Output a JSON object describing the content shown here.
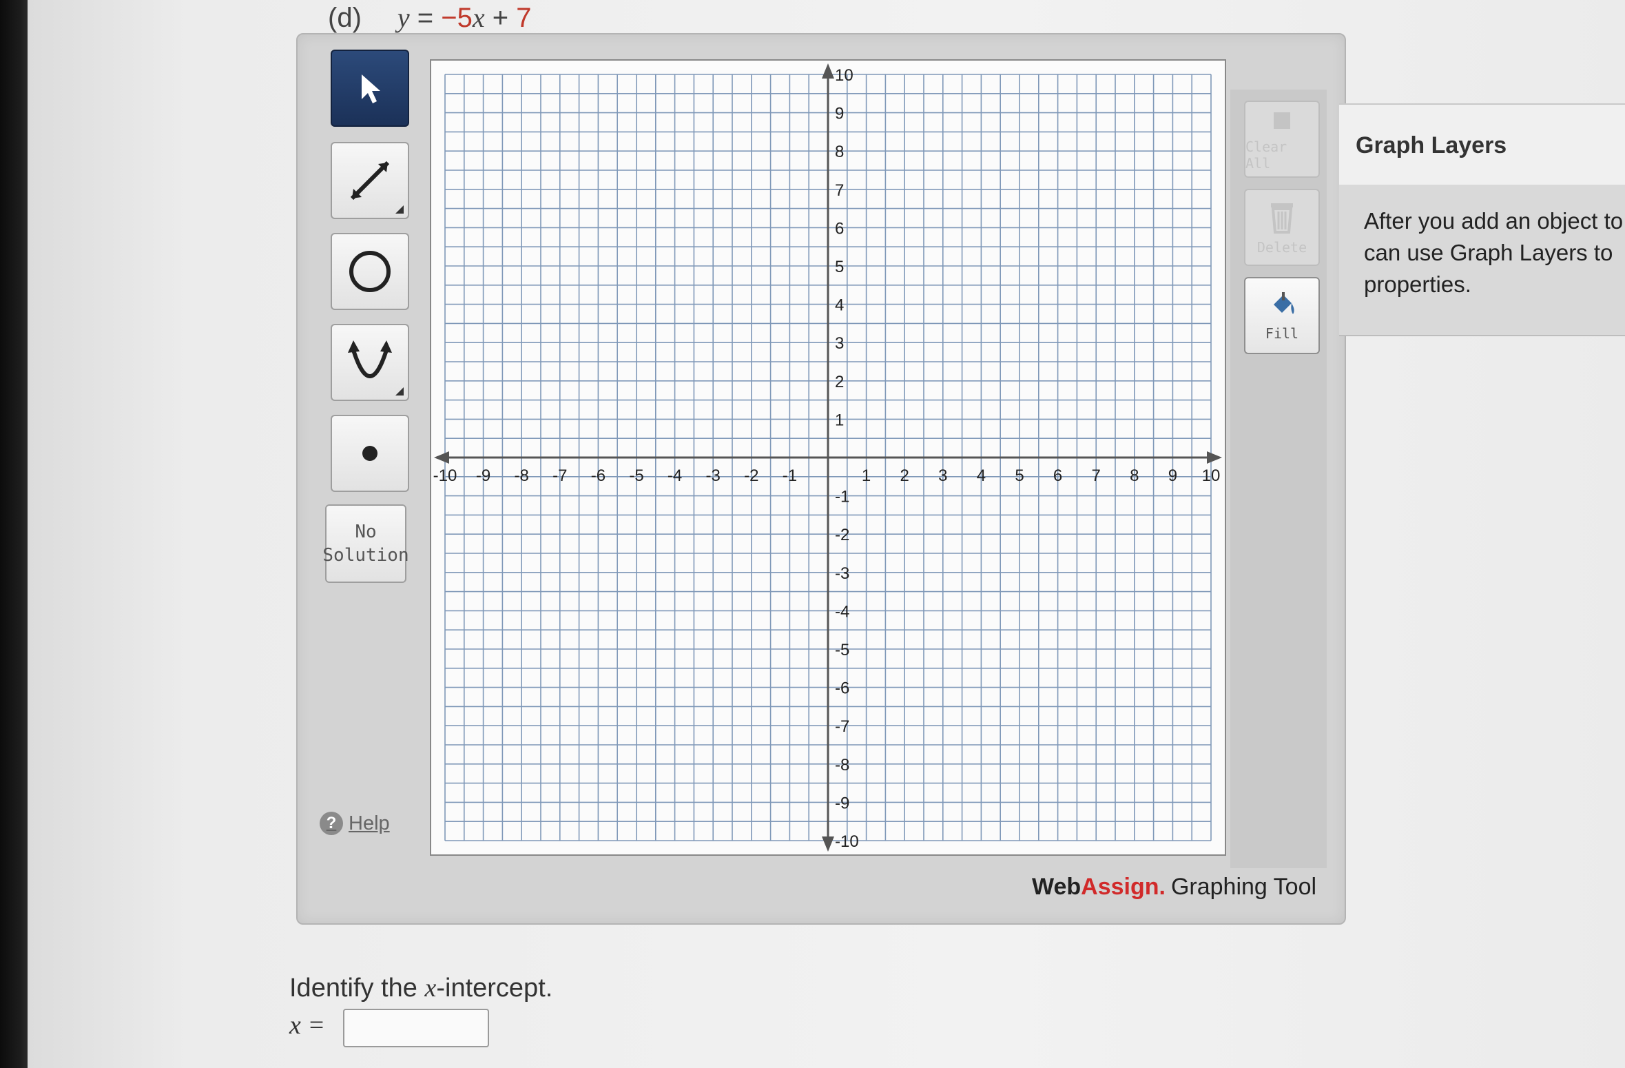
{
  "question": {
    "part_label": "(d)",
    "eq_y": "y",
    "eq_equals": " = ",
    "eq_coef": "−5",
    "eq_x": "x",
    "eq_plus": " + ",
    "eq_const": "7"
  },
  "toolbar": {
    "tools": [
      {
        "name": "pointer",
        "active": true
      },
      {
        "name": "line",
        "active": false
      },
      {
        "name": "circle",
        "active": false
      },
      {
        "name": "parabola",
        "active": false
      },
      {
        "name": "point",
        "active": false
      }
    ],
    "no_solution_label": "No\nSolution",
    "help_label": "Help",
    "help_icon": "?"
  },
  "graph": {
    "x_min": -10,
    "x_max": 10,
    "y_min": -10,
    "y_max": 10,
    "minor_per_unit": 2,
    "x_tick_labels": [
      "-10",
      "-9",
      "-8",
      "-7",
      "-6",
      "-5",
      "-4",
      "-3",
      "-2",
      "-1",
      "1",
      "2",
      "3",
      "4",
      "5",
      "6",
      "7",
      "8",
      "9",
      "10"
    ],
    "y_tick_labels": [
      "10",
      "9",
      "8",
      "7",
      "6",
      "5",
      "4",
      "3",
      "2",
      "1",
      "-1",
      "-2",
      "-3",
      "-4",
      "-5",
      "-6",
      "-7",
      "-8",
      "-9",
      "-10"
    ],
    "grid_color": "#7f98b8",
    "axis_color": "#555555"
  },
  "right_toolbar": {
    "clear_label": "Clear All",
    "delete_label": "Delete",
    "fill_label": "Fill"
  },
  "branding": {
    "web": "Web",
    "assign": "Assign",
    "dot": ".",
    "tool": "Graphing Tool"
  },
  "layers": {
    "title": "Graph Layers",
    "line1": "After you add an object to",
    "line2": "can use Graph Layers to",
    "line3": "properties."
  },
  "prompt": {
    "pre": "Identify the ",
    "var": "x",
    "post": "-intercept.",
    "answer_label": "x =",
    "answer_value": ""
  }
}
